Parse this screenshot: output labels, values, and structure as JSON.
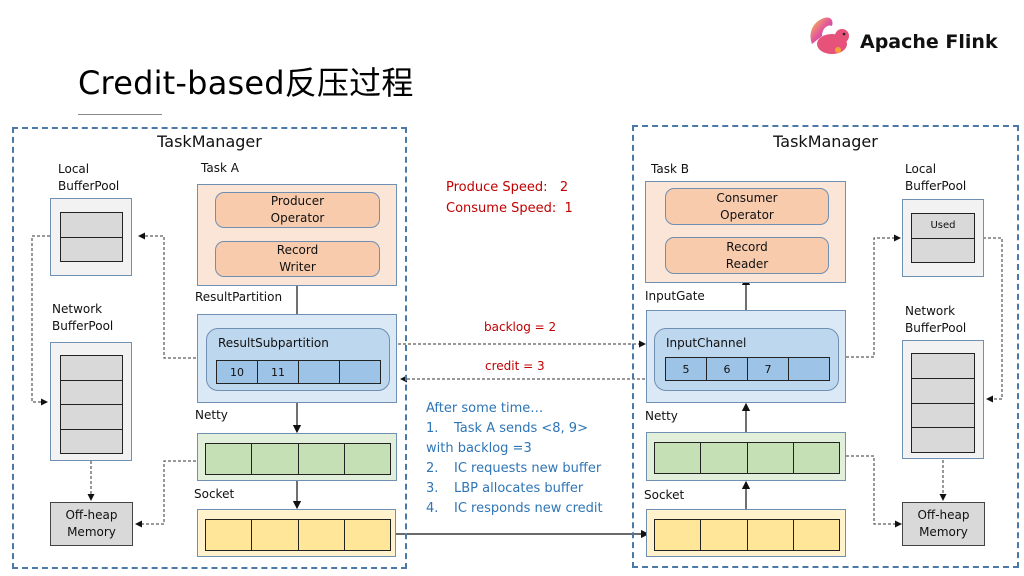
{
  "slide": {
    "title": "Credit-based反压过程",
    "brand": "Apache Flink",
    "logo_icon": "flink-squirrel-logo"
  },
  "left_taskmanager": {
    "title": "TaskManager",
    "local_bufferpool": {
      "label": "Local\nBufferPool",
      "slots": [
        "",
        ""
      ]
    },
    "network_bufferpool": {
      "label": "Network\nBufferPool",
      "slots": [
        "",
        "",
        "",
        ""
      ]
    },
    "offheap": {
      "label": "Off-heap\nMemory"
    },
    "task": {
      "label": "Task A",
      "operator": "Producer\nOperator",
      "io": "Record\nWriter"
    },
    "partition": {
      "label": "ResultPartition",
      "sub_label": "ResultSubpartition",
      "buffers": [
        "10",
        "11",
        "",
        ""
      ]
    },
    "netty": {
      "label": "Netty",
      "buffers": [
        "",
        "",
        "",
        ""
      ]
    },
    "socket": {
      "label": "Socket",
      "buffers": [
        "",
        "",
        "",
        ""
      ]
    }
  },
  "right_taskmanager": {
    "title": "TaskManager",
    "local_bufferpool": {
      "label": "Local\nBufferPool",
      "slots": [
        "Used",
        ""
      ]
    },
    "network_bufferpool": {
      "label": "Network\nBufferPool",
      "slots": [
        "",
        "",
        "",
        ""
      ]
    },
    "offheap": {
      "label": "Off-heap\nMemory"
    },
    "task": {
      "label": "Task B",
      "operator": "Consumer\nOperator",
      "io": "Record\nReader"
    },
    "gate": {
      "label": "InputGate",
      "sub_label": "InputChannel",
      "buffers": [
        "5",
        "6",
        "7",
        ""
      ]
    },
    "netty": {
      "label": "Netty",
      "buffers": [
        "",
        "",
        "",
        ""
      ]
    },
    "socket": {
      "label": "Socket",
      "buffers": [
        "",
        "",
        "",
        ""
      ]
    }
  },
  "speeds": {
    "produce": "Produce Speed:   2",
    "consume": "Consume Speed:  1"
  },
  "messages": {
    "backlog": "backlog = 2",
    "credit": "credit = 3"
  },
  "notes": {
    "heading": "After some time…",
    "items": [
      {
        "num": "1.",
        "text": "Task A sends <8, 9>"
      },
      {
        "num": "",
        "text": "with backlog =3"
      },
      {
        "num": "2.",
        "text": "IC requests new buffer"
      },
      {
        "num": "3.",
        "text": "LBP allocates buffer"
      },
      {
        "num": "4.",
        "text": "IC responds new credit"
      }
    ]
  },
  "colors": {
    "taskmanager_border": "#4a79a8",
    "task_fill": "#fbe5d6",
    "operator_fill": "#f8cbad",
    "partition_fill": "#dbe8f5",
    "buffer_blue": "#9dc3e6",
    "netty_fill": "#c5e0b4",
    "socket_fill": "#ffe699",
    "pool_fill": "#d9d9d9",
    "speed_text": "#c00000",
    "note_text": "#2e75b6"
  }
}
